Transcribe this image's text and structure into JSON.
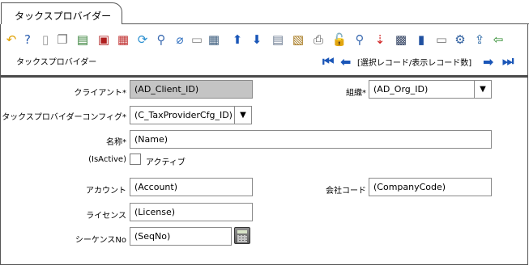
{
  "tab": {
    "title": "タックスプロバイダー"
  },
  "toolbar": {
    "items": [
      {
        "name": "undo-icon",
        "glyph": "↶",
        "color": "#e0a000"
      },
      {
        "name": "help-icon",
        "glyph": "?",
        "color": "#2c5fb0"
      },
      {
        "name": "new-record-icon",
        "glyph": "▯",
        "color": "#999999"
      },
      {
        "name": "copy-record-icon",
        "glyph": "❐",
        "color": "#777777"
      },
      {
        "name": "delete-record-icon",
        "glyph": "▤",
        "color": "#2f7d32"
      },
      {
        "name": "save-icon",
        "glyph": "▣",
        "color": "#b02020"
      },
      {
        "name": "save-new-icon",
        "glyph": "▦",
        "color": "#c03030"
      },
      {
        "name": "refresh-icon",
        "glyph": "⟳",
        "color": "#2a8fd0"
      },
      {
        "name": "find-icon",
        "glyph": "⚲",
        "color": "#3a6ab0"
      },
      {
        "name": "attachment-icon",
        "glyph": "⌀",
        "color": "#3070c0"
      },
      {
        "name": "chat-icon",
        "glyph": "▭",
        "color": "#888888"
      },
      {
        "name": "grid-toggle-icon",
        "glyph": "▦",
        "color": "#406080"
      },
      {
        "name": "parent-record-icon",
        "glyph": "⬆",
        "color": "#1a56b8"
      },
      {
        "name": "detail-record-icon",
        "glyph": "⬇",
        "color": "#1a56b8"
      },
      {
        "name": "history-icon",
        "glyph": "▤",
        "color": "#6a7a90"
      },
      {
        "name": "report-icon",
        "glyph": "▧",
        "color": "#a07010"
      },
      {
        "name": "print-icon",
        "glyph": "⎙",
        "color": "#555555"
      },
      {
        "name": "lock-icon",
        "glyph": "🔓",
        "color": "#e0b000"
      },
      {
        "name": "zoom-across-icon",
        "glyph": "⚲",
        "color": "#3a6ab0"
      },
      {
        "name": "workflow-icon",
        "glyph": "⇣",
        "color": "#d02020"
      },
      {
        "name": "archive-icon",
        "glyph": "▩",
        "color": "#304060"
      },
      {
        "name": "product-info-icon",
        "glyph": "▮",
        "color": "#2050a0"
      },
      {
        "name": "form-view-icon",
        "glyph": "▭",
        "color": "#777777"
      },
      {
        "name": "settings-icon",
        "glyph": "⚙",
        "color": "#3060a0"
      },
      {
        "name": "export-icon",
        "glyph": "⇪",
        "color": "#2060a0"
      },
      {
        "name": "exit-icon",
        "glyph": "⇦",
        "color": "#2a8a2a"
      }
    ]
  },
  "window_label": "タックスプロバイダー",
  "navigation": {
    "first_icon": "⏮",
    "prev_icon": "⬅",
    "next_icon": "➡",
    "last_icon": "⏭",
    "record_status": "[選択レコード/表示レコード数]"
  },
  "form": {
    "client": {
      "label": "クライアント*",
      "value": "(AD_Client_ID)"
    },
    "org": {
      "label": "組織*",
      "value": "(AD_Org_ID)",
      "dropdown": "▼"
    },
    "provider_config": {
      "label": "タックスプロバイダーコンフィグ*",
      "value": "(C_TaxProviderCfg_ID)",
      "dropdown": "▼"
    },
    "name": {
      "label": "名称*",
      "value": "(Name)"
    },
    "is_active": {
      "label": "(IsActive)",
      "checkbox_label": "アクティブ",
      "checked": false
    },
    "account": {
      "label": "アカウント",
      "value": "(Account)"
    },
    "company_code": {
      "label": "会社コード",
      "value": "(CompanyCode)"
    },
    "license": {
      "label": "ライセンス",
      "value": "(License)"
    },
    "seq_no": {
      "label": "シーケンスNo",
      "value": "(SeqNo)"
    }
  }
}
